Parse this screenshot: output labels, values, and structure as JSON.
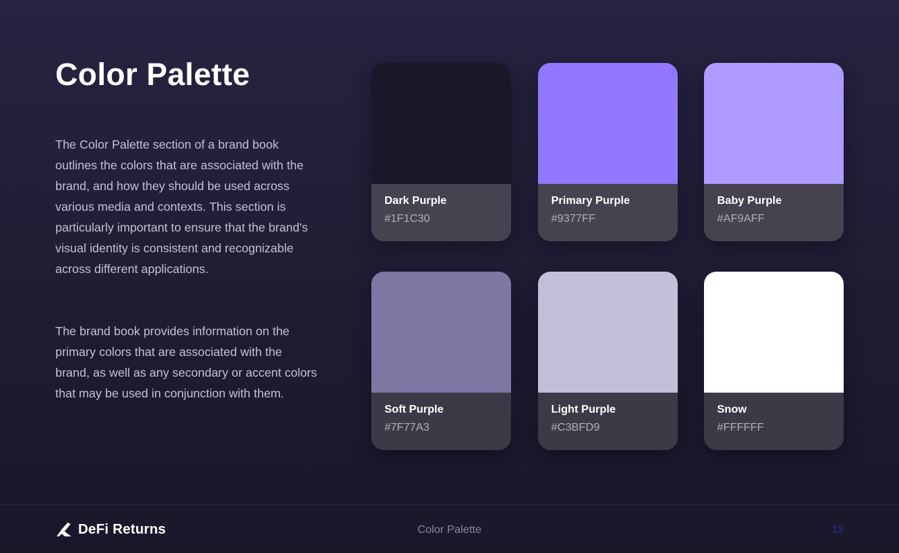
{
  "page": {
    "title": "Color Palette",
    "paragraphs": [
      "The Color Palette section of a brand book outlines the colors that are associated with the brand, and how they should be used across various media and contexts. This section is particularly important to ensure that the brand's visual identity is consistent and recognizable across different applications.",
      "The brand book provides information on the primary colors that are associated with the brand, as well as any secondary or accent colors that may be used in conjunction with them."
    ]
  },
  "swatches": [
    {
      "name": "Dark Purple",
      "hex": "#1F1C30",
      "color": "#1a1729"
    },
    {
      "name": "Primary Purple",
      "hex": "#9377FF",
      "color": "#9377ff"
    },
    {
      "name": "Baby Purple",
      "hex": "#AF9AFF",
      "color": "#af9aff"
    },
    {
      "name": "Soft Purple",
      "hex": "#7F77A3",
      "color": "#7f77a3"
    },
    {
      "name": "Light Purple",
      "hex": "#C3BFD9",
      "color": "#c3bfd9"
    },
    {
      "name": "Snow",
      "hex": "#FFFFFF",
      "color": "#ffffff"
    }
  ],
  "footer": {
    "brand": "DeFi Returns",
    "logo_icon": "defi-returns-logo-icon",
    "section": "Color Palette",
    "page_number": "13"
  }
}
